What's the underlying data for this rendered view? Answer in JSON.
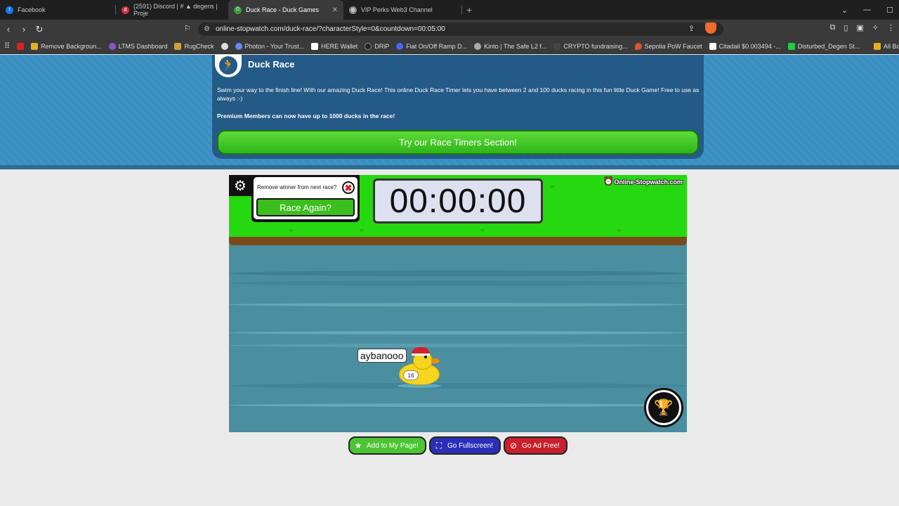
{
  "browser": {
    "tabs": [
      {
        "title": "Facebook",
        "icon": "facebook-icon",
        "color": "#1877f2",
        "active": false
      },
      {
        "title": "(2591) Discord | # ▲ degens | Proje",
        "icon": "discord-icon",
        "color": "#cc3344",
        "active": false
      },
      {
        "title": "Duck Race - Duck Games",
        "icon": "stopwatch-icon",
        "color": "#3a9a3a",
        "active": true
      },
      {
        "title": "VIP Perks Web3 Channel",
        "icon": "globe-icon",
        "color": "#888888",
        "active": false
      }
    ],
    "url": "online-stopwatch.com/duck-race/?characterStyle=0&countdown=00:05:00",
    "bookmarks": [
      {
        "label": "",
        "color": "#e02020"
      },
      {
        "label": "Remove Backgroun...",
        "color": "#e0b020"
      },
      {
        "label": "LTMS Dashboard",
        "color": "#8855cc"
      },
      {
        "label": "RugCheck",
        "color": "#c8a040"
      },
      {
        "label": "",
        "color": "#dddddd"
      },
      {
        "label": "Photon - Your Trust...",
        "color": "#6688ff"
      },
      {
        "label": "HERE Wallet",
        "color": "#ffffff"
      },
      {
        "label": "DRiP",
        "color": "#222222"
      },
      {
        "label": "Fiat On/Off Ramp D...",
        "color": "#4466ff"
      },
      {
        "label": "Kinto | The Safe L2 f...",
        "color": "#aaaaaa"
      },
      {
        "label": "CRYPTO fundraising...",
        "color": "#444444"
      },
      {
        "label": "Sepolia PoW Faucet",
        "color": "#e05030"
      },
      {
        "label": "Citadail $0.003494 -...",
        "color": "#ffffff"
      },
      {
        "label": "Disturbed_Degen St...",
        "color": "#22cc44"
      }
    ],
    "all_bookmarks": "All Bo"
  },
  "hero": {
    "title": "Duck Race",
    "description": "Swim your way to the finish line! With our amazing Duck Race! This online Duck Race Timer lets you have between 2 and 100 ducks racing in this fun little Duck Game! Free to use as always :-)",
    "premium": "Premium Members can now have up to 1000 ducks in the race!",
    "cta": "Try our Race Timers Section!"
  },
  "game": {
    "remove_winner_label": "Remove winner from next race?",
    "race_again_label": "Race Again?",
    "timer": "00:00:00",
    "brand": "Online-Stopwatch.com",
    "duck_name": "aybanooo",
    "duck_number": "16"
  },
  "buttons": {
    "add": "Add to My Page!",
    "fullscreen": "Go Fullscreen!",
    "adfree": "Go Ad Free!"
  }
}
